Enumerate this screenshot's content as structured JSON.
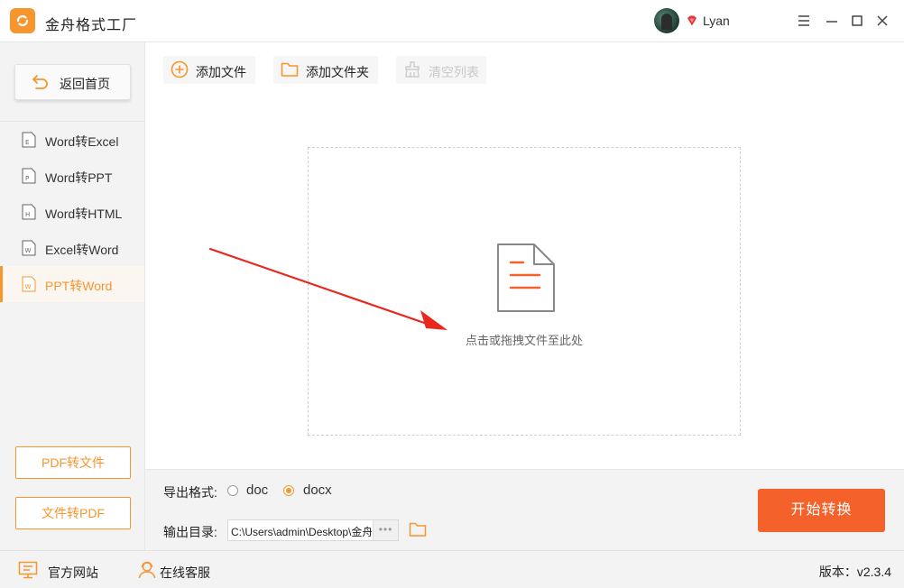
{
  "app": {
    "title": "金舟格式工厂",
    "accent_color": "#f7952f",
    "primary_button_color": "#f4612a"
  },
  "user": {
    "name": "Lyan",
    "badge_icon": "vip-diamond-icon"
  },
  "window_controls": [
    "menu-icon",
    "minimize-icon",
    "maximize-icon",
    "close-icon"
  ],
  "sidebar": {
    "home_label": "返回首页",
    "items": [
      {
        "label": "Word转Excel",
        "icon_letter": "E",
        "active": false
      },
      {
        "label": "Word转PPT",
        "icon_letter": "P",
        "active": false
      },
      {
        "label": "Word转HTML",
        "icon_letter": "H",
        "active": false
      },
      {
        "label": "Excel转Word",
        "icon_letter": "W",
        "active": false
      },
      {
        "label": "PPT转Word",
        "icon_letter": "W",
        "active": true
      }
    ],
    "bottom_buttons": [
      "PDF转文件",
      "文件转PDF"
    ]
  },
  "toolbar": {
    "add_file": "添加文件",
    "add_folder": "添加文件夹",
    "clear_list": "清空列表",
    "clear_list_disabled": true
  },
  "drop_zone": {
    "hint": "点击或拖拽文件至此处"
  },
  "output": {
    "format_label": "导出格式:",
    "formats": [
      {
        "label": "doc",
        "selected": false
      },
      {
        "label": "docx",
        "selected": true
      }
    ],
    "dir_label": "输出目录:",
    "dir_value": "C:\\Users\\admin\\Desktop\\金舟格式工厂",
    "dir_more": "•••",
    "start_label": "开始转换"
  },
  "statusbar": {
    "website": "官方网站",
    "support": "在线客服",
    "version": "版本：v2.3.4"
  }
}
